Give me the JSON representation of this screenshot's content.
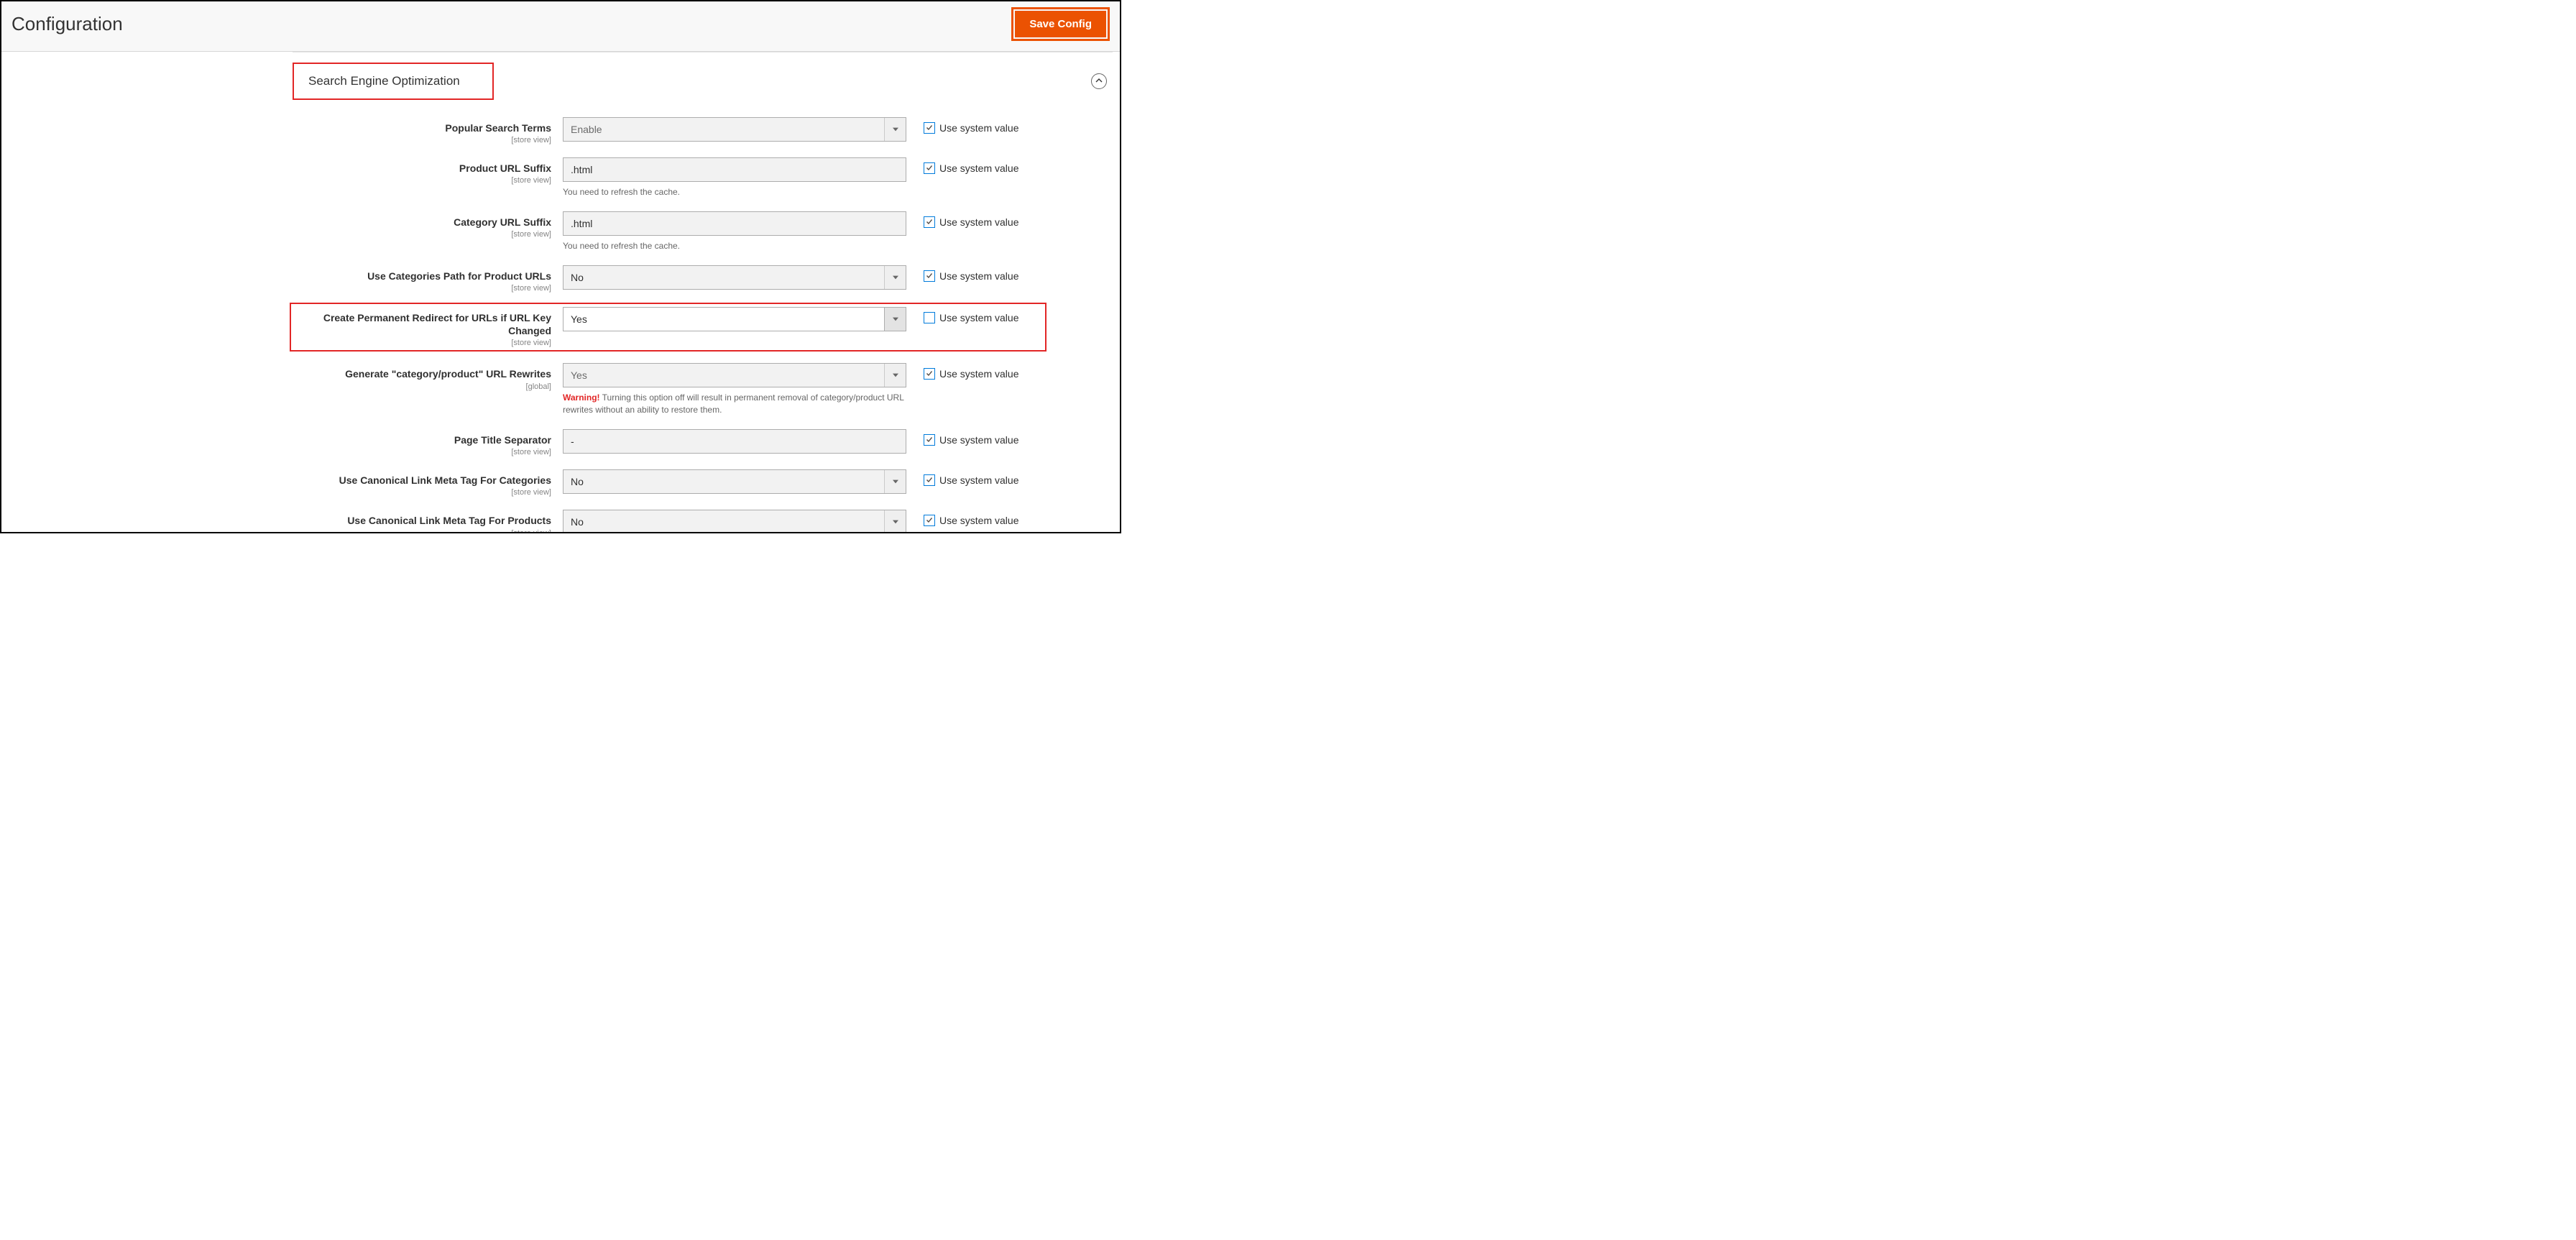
{
  "header": {
    "title": "Configuration",
    "save_label": "Save Config"
  },
  "section": {
    "title": "Search Engine Optimization"
  },
  "sys_label": "Use system value",
  "scope_store": "[store view]",
  "scope_global": "[global]",
  "fields": {
    "popular_search_terms": {
      "label": "Popular Search Terms",
      "value": "Enable",
      "use_system": true
    },
    "product_url_suffix": {
      "label": "Product URL Suffix",
      "value": ".html",
      "use_system": true,
      "note": "You need to refresh the cache."
    },
    "category_url_suffix": {
      "label": "Category URL Suffix",
      "value": ".html",
      "use_system": true,
      "note": "You need to refresh the cache."
    },
    "use_categories_path": {
      "label": "Use Categories Path for Product URLs",
      "value": "No",
      "use_system": true
    },
    "create_redirect": {
      "label": "Create Permanent Redirect for URLs if URL Key Changed",
      "value": "Yes",
      "use_system": false
    },
    "generate_rewrites": {
      "label": "Generate \"category/product\" URL Rewrites",
      "value": "Yes",
      "use_system": true,
      "warn_prefix": "Warning!",
      "warn_text": " Turning this option off will result in permanent removal of category/product URL rewrites without an ability to restore them."
    },
    "page_title_sep": {
      "label": "Page Title Separator",
      "value": "-",
      "use_system": true
    },
    "canonical_cat": {
      "label": "Use Canonical Link Meta Tag For Categories",
      "value": "No",
      "use_system": true
    },
    "canonical_prod": {
      "label": "Use Canonical Link Meta Tag For Products",
      "value": "No",
      "use_system": true
    }
  }
}
